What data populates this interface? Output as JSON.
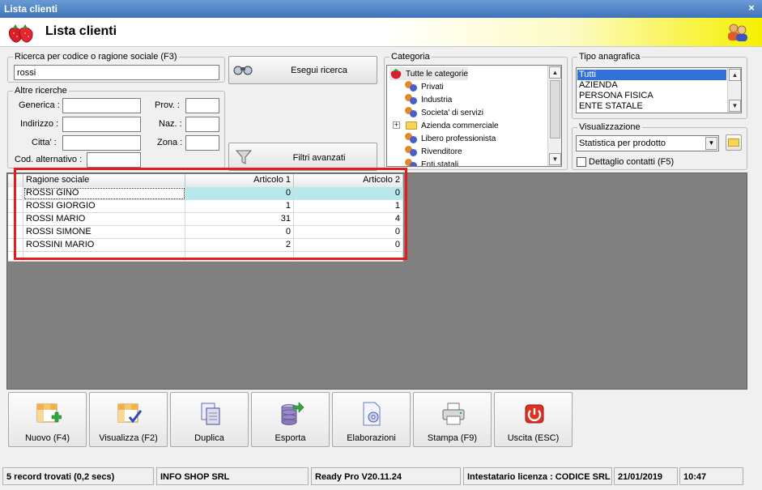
{
  "window": {
    "title": "Lista clienti",
    "close_glyph": "×"
  },
  "header": {
    "title": "Lista clienti",
    "logo_icon": "strawberry-icon",
    "user_icon": "users-icon"
  },
  "search": {
    "legend": "Ricerca per codice o ragione sociale (F3)",
    "value": "rossi"
  },
  "other_search": {
    "legend": "Altre ricerche",
    "generica": "Generica :",
    "indirizzo": "Indirizzo :",
    "citta": "Citta' :",
    "cod_alt": "Cod. alternativo :",
    "prov": "Prov. :",
    "naz": "Naz. :",
    "zona": "Zona :"
  },
  "buttons": {
    "search": "Esegui ricerca",
    "filters": "Filtri avanzati"
  },
  "categoria": {
    "legend": "Categoria",
    "items": [
      "Tutte le categorie",
      "Privati",
      "Industria",
      "Societa' di servizi",
      "Azienda commerciale",
      "Libero professionista",
      "Rivenditore",
      "Enti statali"
    ]
  },
  "tipo": {
    "legend": "Tipo anagrafica",
    "items": [
      "Tutti",
      "AZIENDA",
      "PERSONA FISICA",
      "ENTE STATALE"
    ],
    "selected": "Tutti"
  },
  "visualizzazione": {
    "legend": "Visualizzazione",
    "selected": "Statistica per prodotto",
    "dettaglio": "Dettaglio contatti (F5)"
  },
  "grid": {
    "columns": [
      "Ragione sociale",
      "Articolo 1",
      "Articolo 2"
    ],
    "rows": [
      [
        "ROSSI GINO",
        "0",
        "0"
      ],
      [
        "ROSSI GIORGIO",
        "1",
        "1"
      ],
      [
        "ROSSI MARIO",
        "31",
        "4"
      ],
      [
        "ROSSI SIMONE",
        "0",
        "0"
      ],
      [
        "ROSSINI MARIO",
        "2",
        "0"
      ]
    ]
  },
  "toolbar": {
    "nuovo": "Nuovo (F4)",
    "visualizza": "Visualizza (F2)",
    "duplica": "Duplica",
    "esporta": "Esporta",
    "elaborazioni": "Elaborazioni",
    "stampa": "Stampa (F9)",
    "uscita": "Uscita (ESC)"
  },
  "status": {
    "records": "5 record trovati (0,2 secs)",
    "company": "INFO SHOP SRL",
    "version": "Ready Pro V20.11.24",
    "license": "Intestatario licenza : CODICE SRL",
    "date": "21/01/2019",
    "time": "10:47"
  }
}
